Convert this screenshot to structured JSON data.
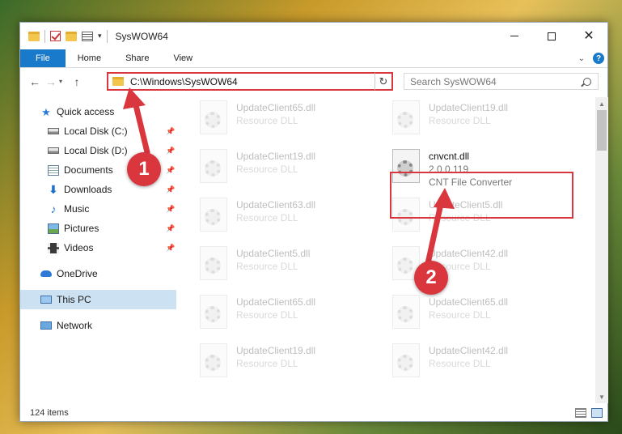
{
  "window": {
    "title": "SysWOW64"
  },
  "ribbon": {
    "tabs": [
      "File",
      "Home",
      "Share",
      "View"
    ]
  },
  "address": {
    "path": "C:\\Windows\\SysWOW64"
  },
  "search": {
    "placeholder": "Search SysWOW64"
  },
  "nav": {
    "items": [
      {
        "label": "Quick access",
        "icon": "star-icon",
        "pinned": false
      },
      {
        "label": "Local Disk (C:)",
        "icon": "drive-icon",
        "pinned": true
      },
      {
        "label": "Local Disk (D:)",
        "icon": "drive-icon",
        "pinned": true
      },
      {
        "label": "Documents",
        "icon": "documents-icon",
        "pinned": true
      },
      {
        "label": "Downloads",
        "icon": "download-icon",
        "pinned": true
      },
      {
        "label": "Music",
        "icon": "music-icon",
        "pinned": true
      },
      {
        "label": "Pictures",
        "icon": "pictures-icon",
        "pinned": true
      },
      {
        "label": "Videos",
        "icon": "videos-icon",
        "pinned": true
      },
      {
        "label": "OneDrive",
        "icon": "cloud-icon",
        "pinned": false
      },
      {
        "label": "This PC",
        "icon": "computer-icon",
        "pinned": false,
        "selected": true
      },
      {
        "label": "Network",
        "icon": "network-icon",
        "pinned": false
      }
    ]
  },
  "files": [
    {
      "name": "UpdateClient65.dll",
      "sub1": "Resource DLL",
      "faded": true
    },
    {
      "name": "UpdateClient19.dll",
      "sub1": "Resource DLL",
      "faded": true
    },
    {
      "name": "UpdateClient19.dll",
      "sub1": "Resource DLL",
      "faded": true
    },
    {
      "name": "cnvcnt.dll",
      "sub1": "2.0.0.119",
      "sub2": "CNT File Converter",
      "faded": false,
      "highlighted": true
    },
    {
      "name": "UpdateClient63.dll",
      "sub1": "Resource DLL",
      "faded": true
    },
    {
      "name": "UpdateClient5.dll",
      "sub1": "Resource DLL",
      "faded": true
    },
    {
      "name": "UpdateClient5.dll",
      "sub1": "Resource DLL",
      "faded": true
    },
    {
      "name": "UpdateClient42.dll",
      "sub1": "Resource DLL",
      "faded": true
    },
    {
      "name": "UpdateClient65.dll",
      "sub1": "Resource DLL",
      "faded": true
    },
    {
      "name": "UpdateClient65.dll",
      "sub1": "Resource DLL",
      "faded": true
    },
    {
      "name": "UpdateClient19.dll",
      "sub1": "Resource DLL",
      "faded": true
    },
    {
      "name": "UpdateClient42.dll",
      "sub1": "Resource DLL",
      "faded": true
    }
  ],
  "status": {
    "count": "124 items"
  },
  "annotations": {
    "step1": "1",
    "step2": "2",
    "color": "#d9363e"
  },
  "colors": {
    "accent": "#1979ca",
    "selection": "#cce1f2",
    "highlight": "#d9363e"
  }
}
